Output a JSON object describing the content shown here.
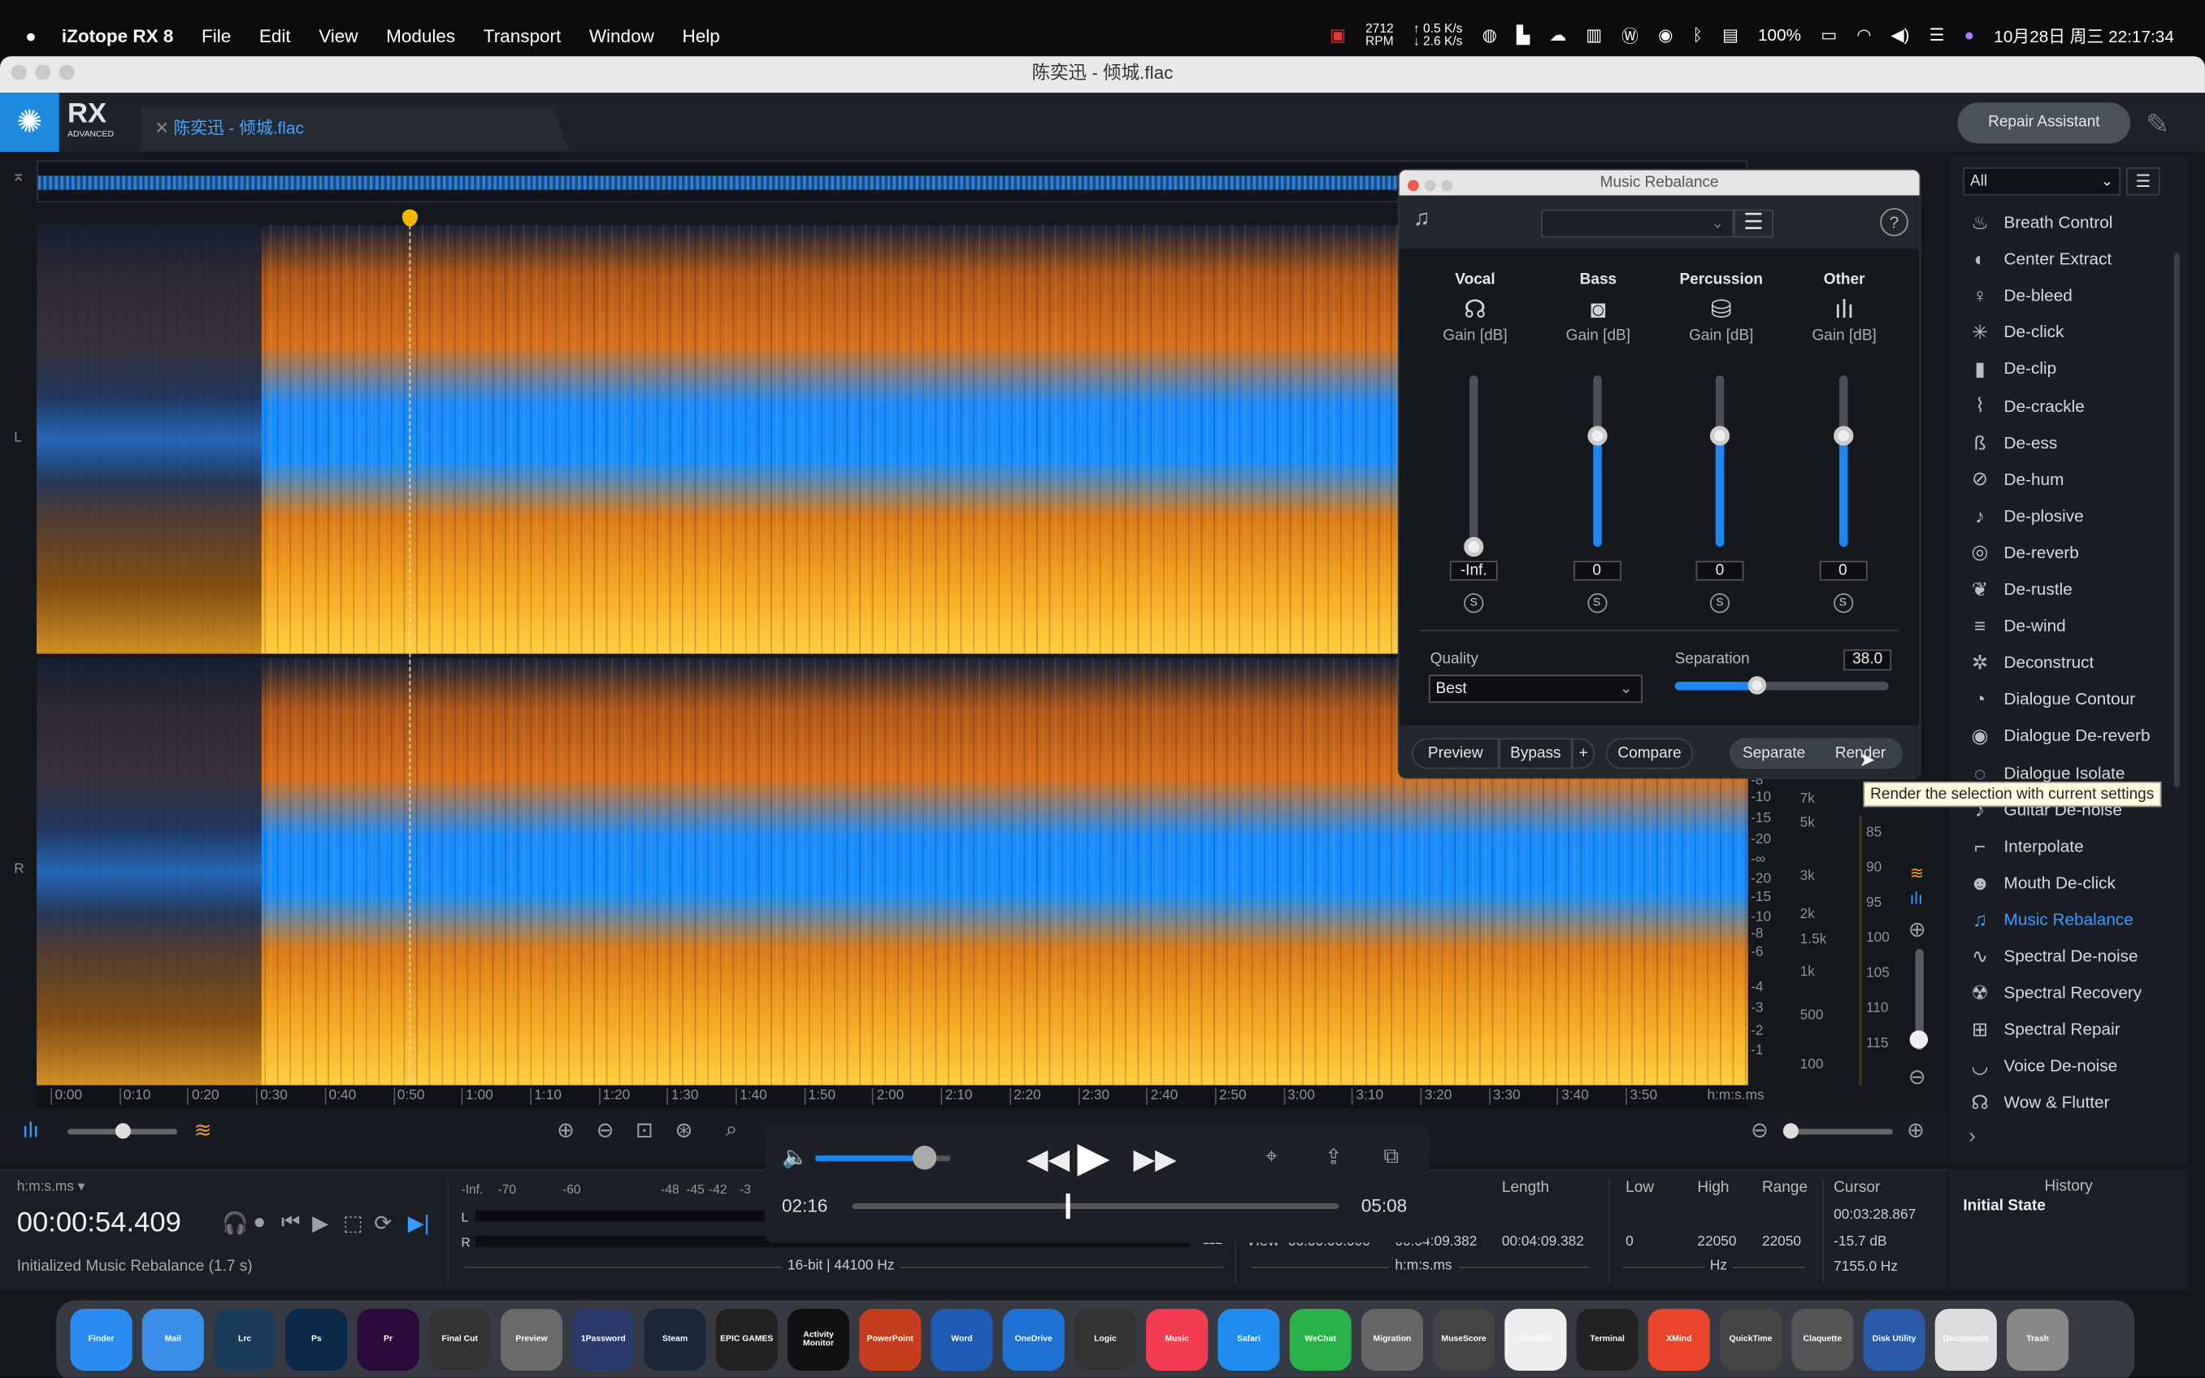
{
  "menubar": {
    "app": "iZotope RX 8",
    "items": [
      "File",
      "Edit",
      "View",
      "Modules",
      "Transport",
      "Window",
      "Help"
    ],
    "rpm": "2712",
    "rpm_unit": "RPM",
    "net_up": "↑ 0.5 K/s",
    "net_down": "↓ 2.6 K/s",
    "battery": "100%",
    "datetime": "10月28日 周三  22:17:34"
  },
  "window": {
    "title": "陈奕迅 - 倾城.flac"
  },
  "app": {
    "logo": "RX",
    "edition": "ADVANCED",
    "file_tab": "陈奕迅 - 倾城.flac",
    "repair_assistant": "Repair Assistant"
  },
  "channels": {
    "left": "L",
    "right": "R"
  },
  "ruler": {
    "labels": [
      "0:00",
      "0:10",
      "0:20",
      "0:30",
      "0:40",
      "0:50",
      "1:00",
      "1:10",
      "1:20",
      "1:30",
      "1:40",
      "1:50",
      "2:00",
      "2:10",
      "2:20",
      "2:30",
      "2:40",
      "2:50",
      "3:00",
      "3:10",
      "3:20",
      "3:30",
      "3:40",
      "3:50"
    ],
    "unit": "h:m:s.ms"
  },
  "db_scale": [
    "-8",
    "-10",
    "-15",
    "-20",
    "-∞",
    "-20",
    "-15",
    "-10",
    "-8",
    "-6",
    "-4",
    "-3",
    "-2",
    "-1"
  ],
  "freq_scale": [
    "7k",
    "5k",
    "3k",
    "2k",
    "1.5k",
    "1k",
    "500",
    "100"
  ],
  "level_scale": [
    "85",
    "90",
    "95",
    "100",
    "105",
    "110",
    "115"
  ],
  "dialog": {
    "title": "Music Rebalance",
    "preset": "",
    "channels": [
      {
        "name": "Vocal",
        "icon": "vocal-head-icon",
        "gain_label": "Gain [dB]",
        "value": "-Inf.",
        "level": 0
      },
      {
        "name": "Bass",
        "icon": "speaker-icon",
        "gain_label": "Gain [dB]",
        "value": "0",
        "level": 0.65
      },
      {
        "name": "Percussion",
        "icon": "drum-icon",
        "gain_label": "Gain [dB]",
        "value": "0",
        "level": 0.65
      },
      {
        "name": "Other",
        "icon": "waveform-icon",
        "gain_label": "Gain [dB]",
        "value": "0",
        "level": 0.65
      }
    ],
    "solo": "S",
    "quality_label": "Quality",
    "quality_value": "Best",
    "separation_label": "Separation",
    "separation_value": "38.0",
    "separation_fraction": 0.38,
    "buttons": {
      "preview": "Preview",
      "bypass": "Bypass",
      "plus": "+",
      "compare": "Compare",
      "separate": "Separate",
      "render": "Render"
    },
    "tooltip": "Render the selection with current settings"
  },
  "sidebar": {
    "filter": "All",
    "active_color": "#3a9bff",
    "modules": [
      "Breath Control",
      "Center Extract",
      "De-bleed",
      "De-click",
      "De-clip",
      "De-crackle",
      "De-ess",
      "De-hum",
      "De-plosive",
      "De-reverb",
      "De-rustle",
      "De-wind",
      "Deconstruct",
      "Dialogue Contour",
      "Dialogue De-reverb",
      "Dialogue Isolate",
      "Guitar De-noise",
      "Interpolate",
      "Mouth De-click",
      "Music Rebalance",
      "Spectral De-noise",
      "Spectral Recovery",
      "Spectral Repair",
      "Voice De-noise",
      "Wow & Flutter"
    ],
    "active": "Music Rebalance"
  },
  "transport": {
    "current": "02:16",
    "total": "05:08",
    "volume": 0.8,
    "progress": 0.44
  },
  "status": {
    "format": "h:m:s.ms ▾",
    "time": "00:00:54.409",
    "message": "Initialized Music Rebalance (1.7 s)",
    "meter_labels": [
      "-Inf.",
      "-70",
      "-60",
      "-48",
      "-45",
      "-42",
      "-3"
    ],
    "meter_min": "-112",
    "bitdepth": "16-bit | 44100 Hz",
    "length_label": "Length",
    "view_label": "View",
    "view_start": "00:00:00.000",
    "view_end": "00:04:09.382",
    "view_length": "00:04:09.382",
    "time_unit": "h:m:s.ms",
    "low_label": "Low",
    "high_label": "High",
    "range_label": "Range",
    "low": "0",
    "high": "22050",
    "range": "22050",
    "hz": "Hz",
    "cursor_label": "Cursor",
    "cursor_time": "00:03:28.867",
    "cursor_db": "-15.7 dB",
    "cursor_hz": "7155.0 Hz"
  },
  "history": {
    "title": "History",
    "items": [
      "Initial State"
    ]
  },
  "dock": [
    "Finder",
    "Mail",
    "Lrc",
    "Ps",
    "Pr",
    "Final Cut",
    "Preview",
    "1Password",
    "Steam",
    "EPIC GAMES",
    "Activity Monitor",
    "PowerPoint",
    "Word",
    "OneDrive",
    "Logic",
    "Music",
    "Safari",
    "WeChat",
    "Migration",
    "MuseScore",
    "TextEdit",
    "Terminal",
    "XMind",
    "QuickTime",
    "Claquette",
    "Disk Utility",
    "Documents",
    "Trash"
  ]
}
